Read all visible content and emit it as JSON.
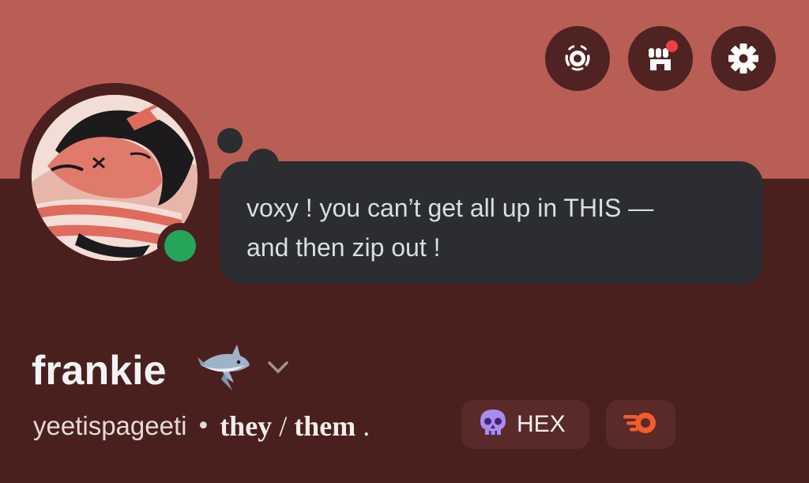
{
  "colors": {
    "banner": "#b85e55",
    "body": "#4a201f",
    "bubble": "#2b2d31",
    "status_online": "#23a55a",
    "notification": "#f23f42"
  },
  "header_icons": [
    {
      "name": "nitro-wreath-icon"
    },
    {
      "name": "shop-icon",
      "has_notification": true
    },
    {
      "name": "gear-icon"
    }
  ],
  "status": {
    "text_line1": "voxy ! you can’t get all up in THIS —",
    "text_line2": "and then zip out !"
  },
  "profile": {
    "display_name": "frankie",
    "username": "yeetispageeti",
    "separator": "•",
    "pronoun_1": "they",
    "pronoun_slash": "/",
    "pronoun_2": "them",
    "pronoun_end": "."
  },
  "badges": {
    "clan_tag": "HEX",
    "clan_icon": "skull-icon",
    "speed_icon": "flame-o-icon"
  }
}
